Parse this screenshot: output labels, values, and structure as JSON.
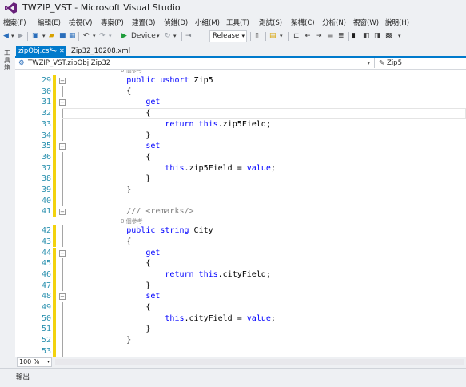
{
  "window": {
    "title": "TWZIP_VST - Microsoft Visual Studio",
    "logo_icon": "visual-studio-logo-icon",
    "accent_color": "#68217a"
  },
  "menu": [
    "檔案(F)",
    "編輯(E)",
    "檢視(V)",
    "專案(P)",
    "建置(B)",
    "偵錯(D)",
    "小組(M)",
    "工具(T)",
    "測試(S)",
    "架構(C)",
    "分析(N)",
    "視窗(W)",
    "說明(H)"
  ],
  "toolbar": {
    "run_label": "Device",
    "config_value": "Release",
    "icons": [
      "back-icon",
      "forward-icon",
      "new-project-icon",
      "open-icon",
      "save-icon",
      "save-all-icon",
      "undo-icon",
      "redo-icon",
      "start-icon",
      "bookmark-icon"
    ]
  },
  "left_strip": {
    "label": "工具箱"
  },
  "tabs": [
    {
      "label": "zipObj.cs*",
      "active": true
    },
    {
      "label": "Zip32_10208.xml",
      "active": false
    }
  ],
  "tab_pin_icon": "pin-icon",
  "tab_close_icon": "close-icon",
  "nav": {
    "left": "TWZIP_VST.zipObj.Zip32",
    "right": "Zip5"
  },
  "editor": {
    "ref_text": "0 個參考",
    "lines": [
      {
        "n": "29",
        "fold": "minus",
        "parts": [
          [
            "kw",
            "            public ushort "
          ],
          [
            "tx",
            "Zip5"
          ]
        ]
      },
      {
        "n": "30",
        "fold": "",
        "parts": [
          [
            "tx",
            "            {"
          ]
        ]
      },
      {
        "n": "31",
        "fold": "minus",
        "parts": [
          [
            "kw",
            "                get"
          ]
        ]
      },
      {
        "n": "32",
        "fold": "",
        "parts": [
          [
            "tx",
            "                {"
          ]
        ]
      },
      {
        "n": "33",
        "fold": "",
        "parts": [
          [
            "kw",
            "                    return this"
          ],
          [
            "tx",
            ".zip5Field;"
          ]
        ]
      },
      {
        "n": "34",
        "fold": "",
        "parts": [
          [
            "tx",
            "                }"
          ]
        ]
      },
      {
        "n": "35",
        "fold": "minus",
        "parts": [
          [
            "kw",
            "                set"
          ]
        ]
      },
      {
        "n": "36",
        "fold": "",
        "parts": [
          [
            "tx",
            "                {"
          ]
        ]
      },
      {
        "n": "37",
        "fold": "",
        "parts": [
          [
            "kw",
            "                    this"
          ],
          [
            "tx",
            ".zip5Field = "
          ],
          [
            "kw",
            "value"
          ],
          [
            "tx",
            ";"
          ]
        ]
      },
      {
        "n": "38",
        "fold": "",
        "parts": [
          [
            "tx",
            "                }"
          ]
        ]
      },
      {
        "n": "39",
        "fold": "",
        "parts": [
          [
            "tx",
            "            }"
          ]
        ]
      },
      {
        "n": "40",
        "fold": "",
        "parts": [
          [
            "tx",
            ""
          ]
        ]
      },
      {
        "n": "41",
        "fold": "minus",
        "parts": [
          [
            "cm",
            "            /// <remarks/>"
          ]
        ]
      },
      {
        "n": "",
        "ref": true
      },
      {
        "n": "42",
        "fold": "",
        "parts": [
          [
            "kw",
            "            public string "
          ],
          [
            "tx",
            "City"
          ]
        ]
      },
      {
        "n": "43",
        "fold": "",
        "parts": [
          [
            "tx",
            "            {"
          ]
        ]
      },
      {
        "n": "44",
        "fold": "minus",
        "parts": [
          [
            "kw",
            "                get"
          ]
        ]
      },
      {
        "n": "45",
        "fold": "",
        "parts": [
          [
            "tx",
            "                {"
          ]
        ]
      },
      {
        "n": "46",
        "fold": "",
        "parts": [
          [
            "kw",
            "                    return this"
          ],
          [
            "tx",
            ".cityField;"
          ]
        ]
      },
      {
        "n": "47",
        "fold": "",
        "parts": [
          [
            "tx",
            "                }"
          ]
        ]
      },
      {
        "n": "48",
        "fold": "minus",
        "parts": [
          [
            "kw",
            "                set"
          ]
        ]
      },
      {
        "n": "49",
        "fold": "",
        "parts": [
          [
            "tx",
            "                {"
          ]
        ]
      },
      {
        "n": "50",
        "fold": "",
        "parts": [
          [
            "kw",
            "                    this"
          ],
          [
            "tx",
            ".cityField = "
          ],
          [
            "kw",
            "value"
          ],
          [
            "tx",
            ";"
          ]
        ]
      },
      {
        "n": "51",
        "fold": "",
        "parts": [
          [
            "tx",
            "                }"
          ]
        ]
      },
      {
        "n": "52",
        "fold": "",
        "parts": [
          [
            "tx",
            "            }"
          ]
        ]
      },
      {
        "n": "53",
        "fold": "",
        "parts": [
          [
            "tx",
            ""
          ]
        ]
      }
    ]
  },
  "status": {
    "zoom": "100 %"
  },
  "bottom_panel": {
    "label": "輸出"
  }
}
